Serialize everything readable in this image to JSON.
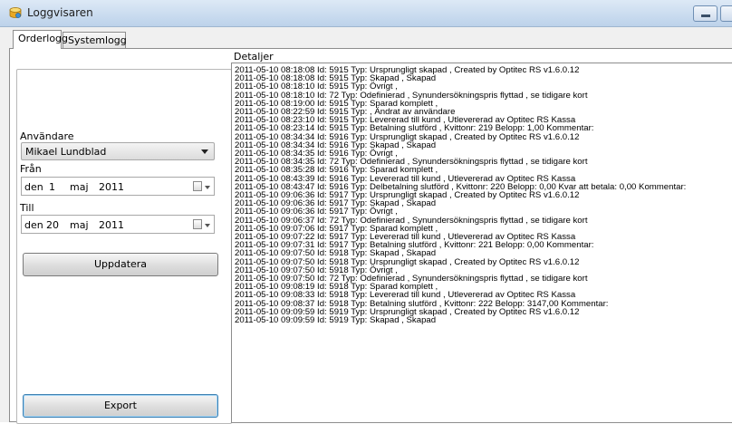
{
  "window": {
    "title": "Loggvisaren",
    "icon": "db-icon"
  },
  "tabs": [
    {
      "label": "Orderlogg",
      "active": true
    },
    {
      "label": "Systemlogg",
      "active": false
    }
  ],
  "left": {
    "user_label": "Användare",
    "user_value": "Mikael Lundblad",
    "from_label": "Från",
    "from_date": {
      "prefix": "den",
      "day": "1",
      "month": "maj",
      "year": "2011"
    },
    "to_label": "Till",
    "to_date": {
      "prefix": "den",
      "day": "20",
      "month": "maj",
      "year": "2011"
    },
    "update_button": "Uppdatera",
    "export_button": "Export"
  },
  "details": {
    "label": "Detaljer",
    "lines": [
      "2011-05-10 08:18:08 Id: 5915 Typ: Ursprungligt skapad , Created by Optitec RS v1.6.0.12",
      "2011-05-10 08:18:08 Id: 5915 Typ: Skapad , Skapad",
      "2011-05-10 08:18:10 Id: 5915 Typ: Övrigt ,",
      "2011-05-10 08:18:10 Id: 72 Typ: Odefinierad , Synundersökningspris flyttad , se tidigare kort",
      "2011-05-10 08:19:00 Id: 5915 Typ: Sparad komplett ,",
      "2011-05-10 08:22:59 Id: 5915 Typ: , Ändrat av användare",
      "2011-05-10 08:23:10 Id: 5915 Typ: Levererad till kund , Utlevererad av Optitec RS Kassa",
      "2011-05-10 08:23:14 Id: 5915 Typ: Betalning slutförd , Kvittonr: 219 Belopp: 1,00 Kommentar:",
      "2011-05-10 08:34:34 Id: 5916 Typ: Ursprungligt skapad , Created by Optitec RS v1.6.0.12",
      "2011-05-10 08:34:34 Id: 5916 Typ: Skapad , Skapad",
      "2011-05-10 08:34:35 Id: 5916 Typ: Övrigt ,",
      "2011-05-10 08:34:35 Id: 72 Typ: Odefinierad , Synundersökningspris flyttad , se tidigare kort",
      "2011-05-10 08:35:28 Id: 5916 Typ: Sparad komplett ,",
      "2011-05-10 08:43:39 Id: 5916 Typ: Levererad till kund , Utlevererad av Optitec RS Kassa",
      "2011-05-10 08:43:47 Id: 5916 Typ: Delbetalning slutförd , Kvittonr: 220 Belopp: 0,00 Kvar att betala: 0,00 Kommentar:",
      "2011-05-10 09:06:36 Id: 5917 Typ: Ursprungligt skapad , Created by Optitec RS v1.6.0.12",
      "2011-05-10 09:06:36 Id: 5917 Typ: Skapad , Skapad",
      "2011-05-10 09:06:36 Id: 5917 Typ: Övrigt ,",
      "2011-05-10 09:06:37 Id: 72 Typ: Odefinierad , Synundersökningspris flyttad , se tidigare kort",
      "2011-05-10 09:07:06 Id: 5917 Typ: Sparad komplett ,",
      "2011-05-10 09:07:22 Id: 5917 Typ: Levererad till kund , Utlevererad av Optitec RS Kassa",
      "2011-05-10 09:07:31 Id: 5917 Typ: Betalning slutförd , Kvittonr: 221 Belopp: 0,00 Kommentar:",
      "2011-05-10 09:07:50 Id: 5918 Typ: Skapad , Skapad",
      "2011-05-10 09:07:50 Id: 5918 Typ: Ursprungligt skapad , Created by Optitec RS v1.6.0.12",
      "2011-05-10 09:07:50 Id: 5918 Typ: Övrigt ,",
      "2011-05-10 09:07:50 Id: 72 Typ: Odefinierad , Synundersökningspris flyttad , se tidigare kort",
      "2011-05-10 09:08:19 Id: 5918 Typ: Sparad komplett ,",
      "2011-05-10 09:08:33 Id: 5918 Typ: Levererad till kund , Utlevererad av Optitec RS Kassa",
      "2011-05-10 09:08:37 Id: 5918 Typ: Betalning slutförd , Kvittonr: 222 Belopp: 3147,00 Kommentar:",
      "2011-05-10 09:09:59 Id: 5919 Typ: Ursprungligt skapad , Created by Optitec RS v1.6.0.12",
      "2011-05-10 09:09:59 Id: 5919 Typ: Skapad , Skapad"
    ]
  },
  "colors": {
    "titlebar": "#c9dbef",
    "window_bg": "#f0f0f0",
    "export_focus": "#3c7fb1"
  }
}
